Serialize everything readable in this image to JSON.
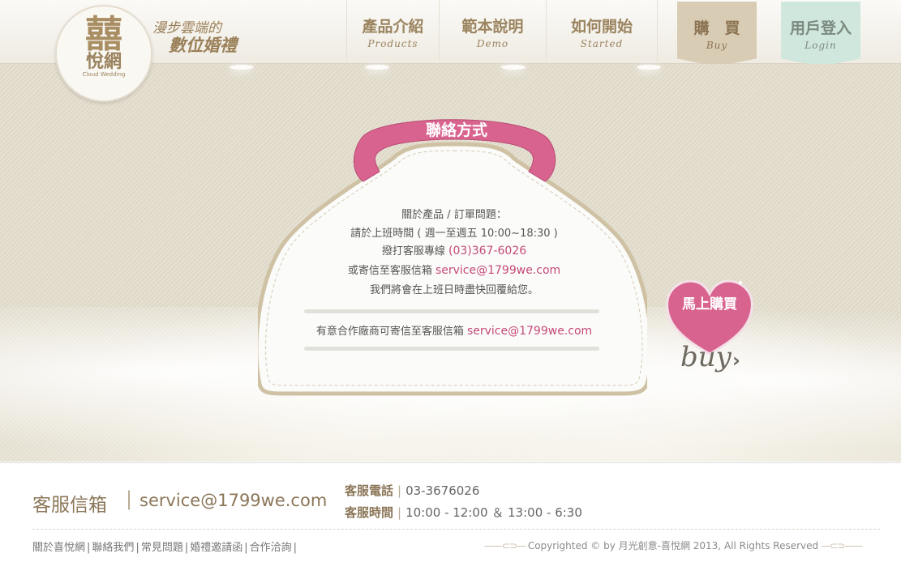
{
  "header": {
    "logo": {
      "mark": "囍",
      "name": "悅網",
      "en": "Cloud Wedding"
    },
    "slogan_line1": "漫步雲端的",
    "slogan_line2": "數位婚禮",
    "nav": [
      {
        "zh": "產品介紹",
        "en": "Products"
      },
      {
        "zh": "範本說明",
        "en": "Demo"
      },
      {
        "zh": "如何開始",
        "en": "Started"
      }
    ],
    "buy": {
      "zh": "購　買",
      "en": "Buy"
    },
    "login": {
      "zh": "用戶登入",
      "en": "Login"
    }
  },
  "contact": {
    "title": "聯絡方式",
    "line1": "關於產品 / 訂單問題：",
    "line2": "請於上班時間 ( 週一至週五 10:00~18:30 )",
    "line3_prefix": "撥打客服專線 ",
    "phone": "(03)367-6026",
    "line4_prefix": "或寄信至客服信箱 ",
    "email": "service@1799we.com",
    "line5": "我們將會在上班日時盡快回覆給您。",
    "partner_prefix": "有意合作廠商可寄信至客服信箱 ",
    "partner_email": "service@1799we.com"
  },
  "buy_now": {
    "label": "馬上購買",
    "script": "buy"
  },
  "footer": {
    "email_label": "客服信箱",
    "email": "service@1799we.com",
    "phone_label": "客服電話",
    "phone": "03-3676026",
    "hours_label": "客服時間",
    "hours": "10:00 - 12:00 ＆ 13:00 - 6:30",
    "links": [
      "關於喜悅網",
      "聯絡我們",
      "常見問題",
      "婚禮邀請函",
      "合作洽詢"
    ],
    "copyright": "Copyrighted © by 月光創意-喜悅網 2013, All Rights Reserved"
  },
  "colors": {
    "brand": "#9b845f",
    "pink": "#d9638f",
    "mint": "#cfe7dc"
  }
}
